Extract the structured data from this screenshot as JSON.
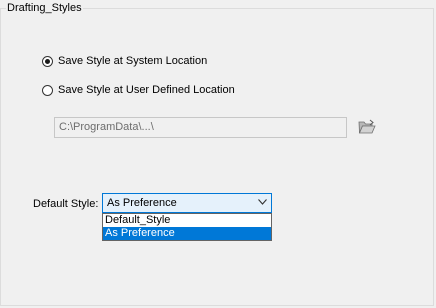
{
  "group": {
    "title": "Drafting_Styles"
  },
  "location": {
    "option_system": "Save Style at System Location",
    "option_user": "Save Style at User Defined Location",
    "selected": "system",
    "path_value": "C:\\ProgramData\\...\\"
  },
  "default_style": {
    "label": "Default Style:",
    "value": "As Preference",
    "options": [
      "Default_Style",
      "As Preference"
    ],
    "highlighted": "As Preference"
  },
  "icons": {
    "browse": "folder-open-icon",
    "dropdown": "chevron-down-icon"
  },
  "colors": {
    "selection": "#0078d7",
    "select_bg": "#e5f1fb"
  }
}
